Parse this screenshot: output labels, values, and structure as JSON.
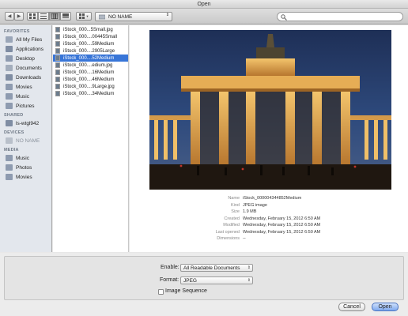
{
  "window": {
    "title": "Open"
  },
  "toolbar": {
    "location": "NO NAME",
    "search_placeholder": ""
  },
  "sidebar": {
    "sections": [
      {
        "title": "FAVORITES",
        "items": [
          {
            "label": "All My Files",
            "icon": "all-files-icon",
            "color": "#9aa6b8"
          },
          {
            "label": "Applications",
            "icon": "applications-icon",
            "color": "#7f8da3"
          },
          {
            "label": "Desktop",
            "icon": "desktop-icon",
            "color": "#8e9bb0"
          },
          {
            "label": "Documents",
            "icon": "documents-icon",
            "color": "#a3adbc"
          },
          {
            "label": "Downloads",
            "icon": "downloads-icon",
            "color": "#7f8da3"
          },
          {
            "label": "Movies",
            "icon": "movies-icon",
            "color": "#8e9bb0"
          },
          {
            "label": "Music",
            "icon": "music-icon",
            "color": "#8e9bb0"
          },
          {
            "label": "Pictures",
            "icon": "pictures-icon",
            "color": "#8e9bb0"
          }
        ]
      },
      {
        "title": "SHARED",
        "items": [
          {
            "label": "ls-wtgl942",
            "icon": "shared-computer-icon",
            "color": "#7f8da3"
          }
        ]
      },
      {
        "title": "DEVICES",
        "items": [
          {
            "label": "NO NAME",
            "icon": "disk-icon",
            "color": "#b9c0ca",
            "muted": true
          }
        ]
      },
      {
        "title": "MEDIA",
        "items": [
          {
            "label": "Music",
            "icon": "music-icon",
            "color": "#8e9bb0"
          },
          {
            "label": "Photos",
            "icon": "photos-icon",
            "color": "#8e9bb0"
          },
          {
            "label": "Movies",
            "icon": "movies-icon",
            "color": "#8e9bb0"
          }
        ]
      }
    ]
  },
  "files": [
    {
      "name": "iStock_000...5Small.jpg",
      "selected": false
    },
    {
      "name": "iStock_000....00445Small",
      "selected": false
    },
    {
      "name": "iStock_000....59Medium",
      "selected": false
    },
    {
      "name": "iStock_000....2905Large",
      "selected": false
    },
    {
      "name": "iStock_000....52Medium",
      "selected": true
    },
    {
      "name": "iStock_000....edium.jpg",
      "selected": false
    },
    {
      "name": "iStock_000....16Medium",
      "selected": false
    },
    {
      "name": "iStock_000....46Medium",
      "selected": false
    },
    {
      "name": "iStock_000....9Large.jpg",
      "selected": false
    },
    {
      "name": "iStock_000....34Medium",
      "selected": false
    }
  ],
  "info": [
    {
      "key": "Name",
      "value": "iStock_000004344852Medium"
    },
    {
      "key": "Kind",
      "value": "JPEG image"
    },
    {
      "key": "Size",
      "value": "1.9 MB"
    },
    {
      "key": "Created",
      "value": "Wednesday, February 15, 2012 6:50 AM"
    },
    {
      "key": "Modified",
      "value": "Wednesday, February 15, 2012 6:50 AM"
    },
    {
      "key": "Last opened",
      "value": "Wednesday, February 15, 2012 6:50 AM"
    },
    {
      "key": "Dimensions",
      "value": "--"
    }
  ],
  "options": {
    "enable_label": "Enable:",
    "enable_value": "All Readable Documents",
    "format_label": "Format:",
    "format_value": "JPEG",
    "image_sequence_label": "Image Sequence",
    "image_sequence_checked": false
  },
  "buttons": {
    "cancel": "Cancel",
    "open": "Open"
  }
}
